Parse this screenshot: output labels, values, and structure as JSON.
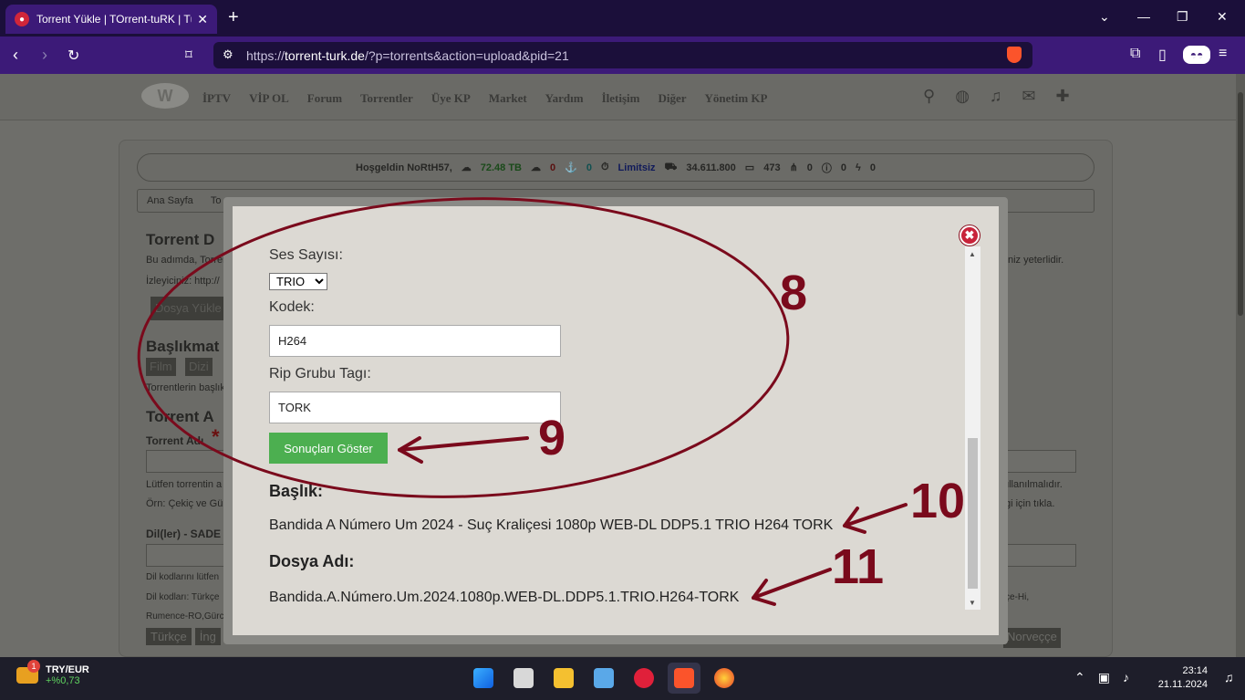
{
  "browser": {
    "tab_title": "Torrent Yükle | TOrrent-tuRK | Tü",
    "new_tab": "+",
    "url_prefix": "https://",
    "url_domain": "torrent-turk.de",
    "url_path": "/?p=torrents&action=upload&pid=21"
  },
  "site": {
    "logo_text": "W",
    "menu": [
      "İPTV",
      "VİP OL",
      "Forum",
      "Torrentler",
      "Üye KP",
      "Market",
      "Yardım",
      "İletişim",
      "Diğer",
      "Yönetim KP"
    ],
    "welcome": {
      "greeting": "Hoşgeldin NoRtH57,",
      "upload": "72.48 TB",
      "download": "0",
      "seeds": "0",
      "limit": "Limitsiz",
      "points": "34.611.800",
      "comments": "473",
      "share": "0",
      "warn": "0",
      "bolt": "0"
    },
    "breadcrumb_home": "Ana Sayfa",
    "breadcrumb_second": "To",
    "page_heading": "Torrent D",
    "intro_line1": "Bu adımda, Torrent",
    "intro_right1": "niz yeterlidir.",
    "intro_line2": "İzleyiciniz: http://",
    "upload_button": "Dosya Yükle",
    "section_title": "Başlıkmat",
    "film_button": "Film",
    "dizi_button": "Dizi",
    "section_note": "Torrentlerin başlık",
    "torrent_heading": "Torrent A",
    "torrent_name_label": "Torrent Adı",
    "required_mark": "*",
    "hint1": "Lütfen torrentin a",
    "hint1_right": "ullanılmalıdır.",
    "hint2": "Örn: Çekiç ve Gül",
    "hint2_right": "gi için tıkla.",
    "lang_label": "Dil(ler) - SADE",
    "lang_hint1": "Dil kodlarını lütfen",
    "lang_hint2": "Dil kodları: Türkçe",
    "lang_hint2_right": "çe-Hi,",
    "lang_hint3": "Rumence-RO,Gürc",
    "lang_buttons": [
      "Türkçe",
      "İng"
    ],
    "lang_last": "Norveççe"
  },
  "modal": {
    "ses_label": "Ses Sayısı:",
    "ses_value": "TRIO",
    "kodek_label": "Kodek:",
    "kodek_value": "H264",
    "rip_label": "Rip Grubu Tagı:",
    "rip_value": "TORK",
    "show_button": "Sonuçları Göster",
    "baslik_label": "Başlık:",
    "baslik_value": "Bandida A Número Um 2024 - Suç Kraliçesi 1080p WEB-DL DDP5.1 TRIO H264 TORK",
    "dosya_label": "Dosya Adı:",
    "dosya_value": "Bandida.A.Número.Um.2024.1080p.WEB-DL.DDP5.1.TRIO.H264-TORK",
    "close_glyph": "✖"
  },
  "annotations": [
    "8",
    "9",
    "10",
    "11"
  ],
  "taskbar": {
    "ticker_pair": "TRY/EUR",
    "ticker_change": "+%0,73",
    "ticker_badge": "1",
    "time": "23:14",
    "date": "21.11.2024"
  },
  "colors": {
    "annotation": "#7a0a1c",
    "accent_green": "#4caf50",
    "browser_purple": "#3c1a78"
  }
}
